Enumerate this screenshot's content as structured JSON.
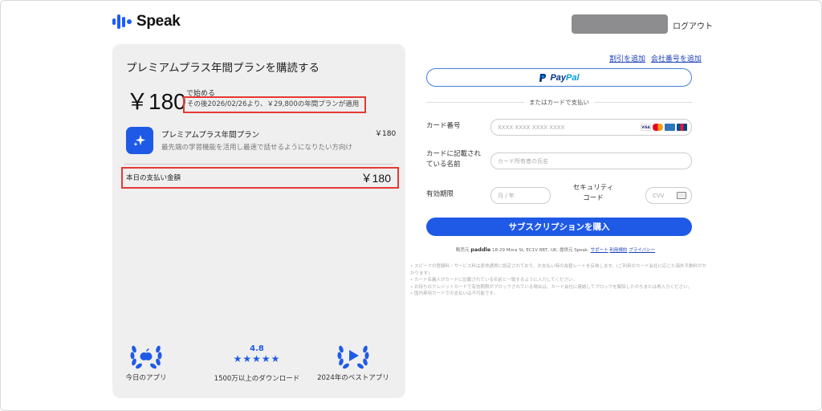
{
  "header": {
    "brand": "Speak",
    "logout": "ログアウト"
  },
  "summary": {
    "title": "プレミアムプラス年間プランを購読する",
    "price": "￥180",
    "start_label": "で始める",
    "after_note": "その後2026/02/26より、￥29,800の年間プランが適用",
    "plan_name": "プレミアムプラス年間プラン",
    "plan_desc": "最先端の学習機能を活用し最速で話せるようになりたい方向け",
    "plan_price": "￥180",
    "total_label": "本日の支払い金額",
    "total_amount": "￥180"
  },
  "badges": [
    {
      "icon": "apple-icon",
      "caption": "今日のアプリ"
    },
    {
      "rating": "4.8",
      "stars": "★★★★★",
      "caption": "1500万以上のダウンロード"
    },
    {
      "icon": "google-play-icon",
      "caption": "2024年のベストアプリ"
    }
  ],
  "checkout": {
    "discount_link": "割引を追加",
    "company_link": "会社番号を追加",
    "paypal_brand_1": "Pay",
    "paypal_brand_2": "Pal",
    "or_card": "またはカードで支払い",
    "card_number_label": "カード番号",
    "card_number_placeholder": "XXXX XXXX XXXX XXXX",
    "cardholder_label_1": "カードに記載され",
    "cardholder_label_2": "ている名前",
    "cardholder_placeholder": "カード所有者の氏名",
    "expiry_label": "有効期限",
    "expiry_placeholder": "月 / 年",
    "security_label_1": "セキュリティ",
    "security_label_2": "コード",
    "cvv_placeholder": "CVV",
    "subscribe_button": "サブスクリプションを購入"
  },
  "seller": {
    "prefix": "販売元",
    "paddle": "paddle",
    "address": "18-29 Mora St, EC1V 8BT, UK. 提供元 Speak.",
    "support": "サポート",
    "terms": "利用規約",
    "privacy": "プライバシー"
  },
  "notes": [
    "スピークの登録料・サービス料は原地通貨に設定されており、お支払い時の為替レートを反映します。(ご利用のカード会社に応じた海外手数料がかかります)",
    "カード名義人がカードに記載されている名前と一致するように入力してください。",
    "お持ちのクレジットカードで有効期限がブロックされている場合は、カード会社に連絡してブロックを解除したのちまたは再入力ください。",
    "国内専用カードでの支払いは不可能です。"
  ],
  "colors": {
    "accent": "#1f5ae6",
    "highlight": "#e53935",
    "panel": "#efefef"
  }
}
